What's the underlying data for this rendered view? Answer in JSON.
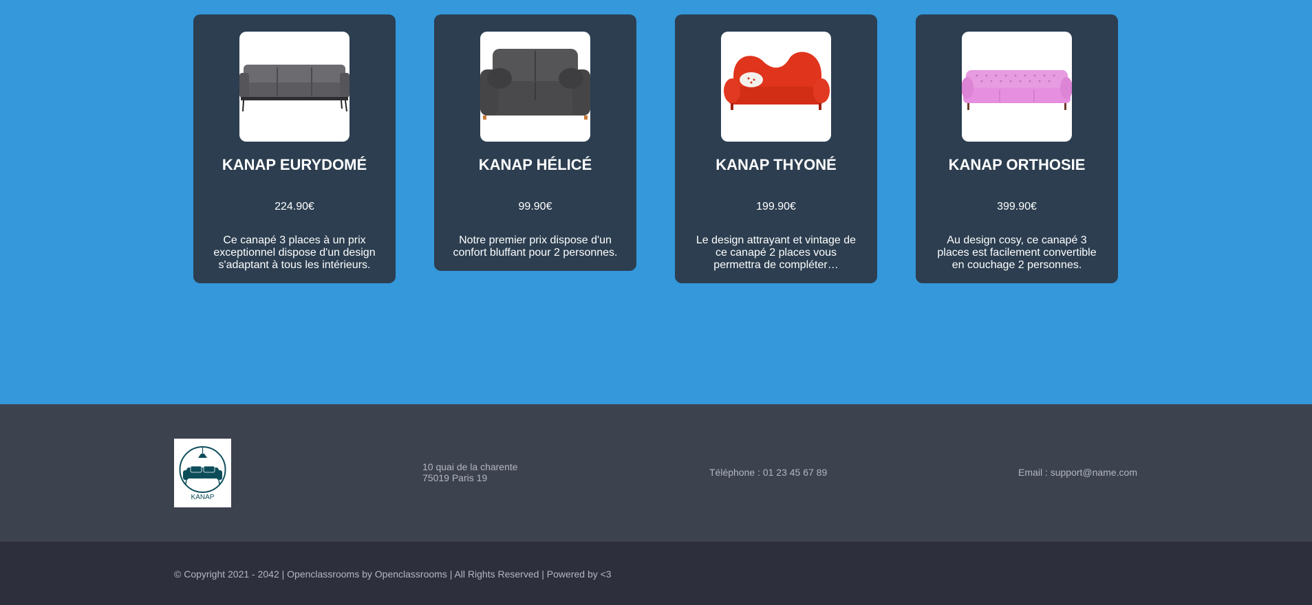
{
  "products": [
    {
      "name": "KANAP EURYDOMÉ",
      "price": "224.90€",
      "description": "Ce canapé 3 places à un prix exceptionnel dispose d'un design s'adaptant à tous les intérieurs.",
      "image_alt": "Lorem ipsum dolor sit amet, Kanap name1",
      "sofa_color": "#5c5c60"
    },
    {
      "name": "KANAP HÉLICÉ",
      "price": "99.90€",
      "description": "Notre premier prix dispose d'un confort bluffant pour 2 personnes.",
      "image_alt": "Lorem ipsum dolor sit amet, Kanap name2",
      "sofa_color": "#4a4a4c"
    },
    {
      "name": "KANAP THYONÉ",
      "price": "199.90€",
      "description": "Le design attrayant et vintage de ce canapé 2 places vous permettra de compléter…",
      "image_alt": "Lorem ipsum dolor sit amet, Kanap name3",
      "sofa_color": "#e0341c"
    },
    {
      "name": "KANAP ORTHOSIE",
      "price": "399.90€",
      "description": "Au design cosy, ce canapé 3 places est facilement convertible en couchage 2 personnes.",
      "image_alt": "Lorem ipsum dolor sit amet, Kanap name4",
      "sofa_color": "#e68ee0"
    }
  ],
  "footer": {
    "logo_text": "KANAP",
    "address_line1": "10 quai de la charente",
    "address_line2": "75019 Paris 19",
    "phone": "Téléphone : 01 23 45 67 89",
    "email": "Email : support@name.com",
    "copyright": "© Copyright 2021 - 2042 | Openclassrooms by Openclassrooms | All Rights Reserved | Powered by <3"
  },
  "colors": {
    "page_background": "#3498db",
    "card_background": "#2c3e50",
    "footer_top": "#3d424f",
    "footer_bottom": "#2d2f3d",
    "logo_accent": "#0d4d5a"
  }
}
